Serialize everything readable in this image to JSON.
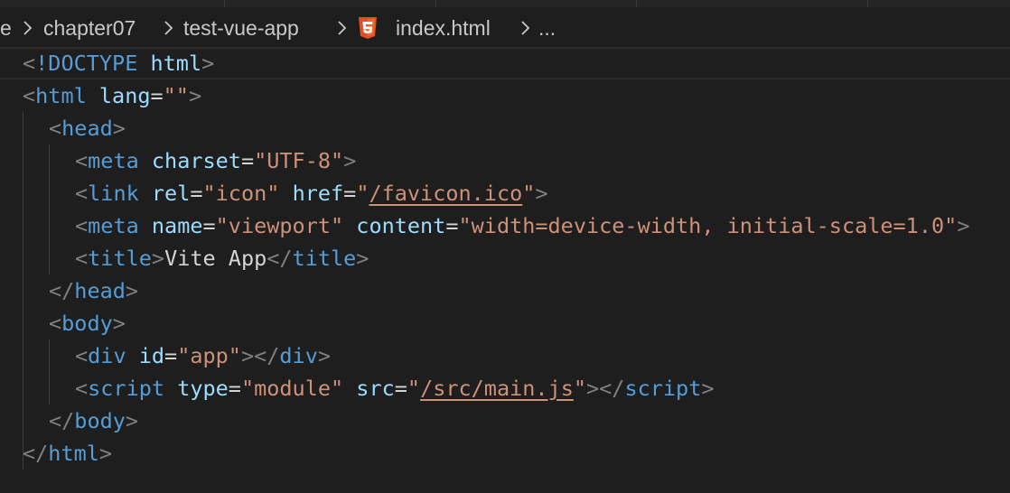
{
  "breadcrumb": {
    "items": [
      "e",
      "chapter07",
      "test-vue-app",
      "index.html",
      "..."
    ],
    "file_icon": "html5-icon"
  },
  "code": {
    "lines": [
      [
        [
          "br",
          "<"
        ],
        [
          "tg",
          "!DOCTYPE "
        ],
        [
          "at",
          "html"
        ],
        [
          "br",
          ">"
        ]
      ],
      [
        [
          "br",
          "<"
        ],
        [
          "tg",
          "html "
        ],
        [
          "at",
          "lang"
        ],
        [
          "tx",
          "="
        ],
        [
          "st",
          "\"\""
        ],
        [
          "br",
          ">"
        ]
      ],
      [
        [
          "br",
          "<"
        ],
        [
          "tg",
          "head"
        ],
        [
          "br",
          ">"
        ]
      ],
      [
        [
          "br",
          "<"
        ],
        [
          "tg",
          "meta "
        ],
        [
          "at",
          "charset"
        ],
        [
          "tx",
          "="
        ],
        [
          "st",
          "\"UTF-8\""
        ],
        [
          "br",
          ">"
        ]
      ],
      [
        [
          "br",
          "<"
        ],
        [
          "tg",
          "link "
        ],
        [
          "at",
          "rel"
        ],
        [
          "tx",
          "="
        ],
        [
          "st",
          "\"icon\" "
        ],
        [
          "at",
          "href"
        ],
        [
          "tx",
          "="
        ],
        [
          "st",
          "\""
        ],
        [
          "stu",
          "/favicon.ico"
        ],
        [
          "st",
          "\""
        ],
        [
          "br",
          ">"
        ]
      ],
      [
        [
          "br",
          "<"
        ],
        [
          "tg",
          "meta "
        ],
        [
          "at",
          "name"
        ],
        [
          "tx",
          "="
        ],
        [
          "st",
          "\"viewport\" "
        ],
        [
          "at",
          "content"
        ],
        [
          "tx",
          "="
        ],
        [
          "st",
          "\"width=device-width, initial-scale=1.0\""
        ],
        [
          "br",
          ">"
        ]
      ],
      [
        [
          "br",
          "<"
        ],
        [
          "tg",
          "title"
        ],
        [
          "br",
          ">"
        ],
        [
          "tx",
          "Vite App"
        ],
        [
          "br",
          "</"
        ],
        [
          "tg",
          "title"
        ],
        [
          "br",
          ">"
        ]
      ],
      [
        [
          "br",
          "</"
        ],
        [
          "tg",
          "head"
        ],
        [
          "br",
          ">"
        ]
      ],
      [
        [
          "br",
          "<"
        ],
        [
          "tg",
          "body"
        ],
        [
          "br",
          ">"
        ]
      ],
      [
        [
          "br",
          "<"
        ],
        [
          "tg",
          "div "
        ],
        [
          "at",
          "id"
        ],
        [
          "tx",
          "="
        ],
        [
          "st",
          "\"app\""
        ],
        [
          "br",
          "></"
        ],
        [
          "tg",
          "div"
        ],
        [
          "br",
          ">"
        ]
      ],
      [
        [
          "br",
          "<"
        ],
        [
          "tg",
          "script "
        ],
        [
          "at",
          "type"
        ],
        [
          "tx",
          "="
        ],
        [
          "st",
          "\"module\" "
        ],
        [
          "at",
          "src"
        ],
        [
          "tx",
          "="
        ],
        [
          "st",
          "\""
        ],
        [
          "stu",
          "/src/main.js"
        ],
        [
          "st",
          "\""
        ],
        [
          "br",
          "></"
        ],
        [
          "tg",
          "script"
        ],
        [
          "br",
          ">"
        ]
      ],
      [
        [
          "br",
          "</"
        ],
        [
          "tg",
          "body"
        ],
        [
          "br",
          ">"
        ]
      ],
      [
        [
          "br",
          "</"
        ],
        [
          "tg",
          "html"
        ],
        [
          "br",
          ">"
        ]
      ]
    ]
  },
  "colors": {
    "background": "#1e1e1e",
    "bracket": "#808080",
    "tag": "#569cd6",
    "attribute": "#9cdcfe",
    "string": "#ce9178",
    "text": "#d4d4d4",
    "html5_icon": "#e44d26"
  }
}
